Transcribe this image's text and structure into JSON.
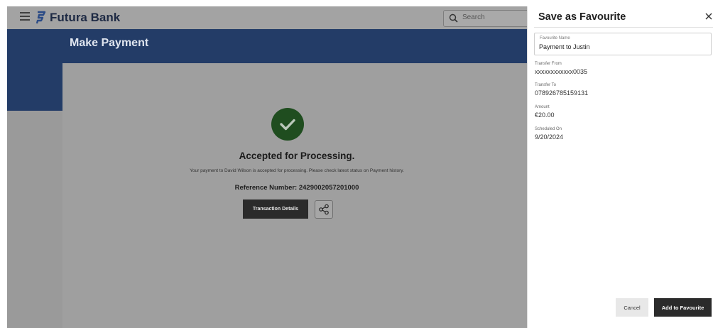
{
  "header": {
    "brand_name": "Futura Bank",
    "search_placeholder": "Search"
  },
  "page": {
    "title": "Make Payment"
  },
  "confirmation": {
    "title": "Accepted for Processing.",
    "message": "Your payment to David Wilson is accepted for processing. Please check latest status on Payment history.",
    "reference": "Reference Number: 2429002057201000",
    "transaction_details_label": "Transaction Details"
  },
  "favourite_drawer": {
    "title": "Save as Favourite",
    "favourite_name_label": "Favourite Name",
    "favourite_name_value": "Payment to Justin",
    "transfer_from_label": "Transfer From",
    "transfer_from_value": "xxxxxxxxxxxx0035",
    "transfer_to_label": "Transfer To",
    "transfer_to_value": "078926785159131",
    "amount_label": "Amount",
    "amount_value": "€20.00",
    "scheduled_on_label": "Scheduled On",
    "scheduled_on_value": "9/20/2024",
    "cancel_label": "Cancel",
    "add_label": "Add to Favourite"
  },
  "colors": {
    "brand_blue": "#233c67",
    "success_green": "#1f4d1f",
    "button_dark": "#2b2b2b",
    "overlay_gray": "#9a9a9a"
  },
  "icons": [
    "hamburger-icon",
    "bank-logo-icon",
    "search-icon",
    "checkmark-icon",
    "share-icon",
    "close-icon"
  ]
}
